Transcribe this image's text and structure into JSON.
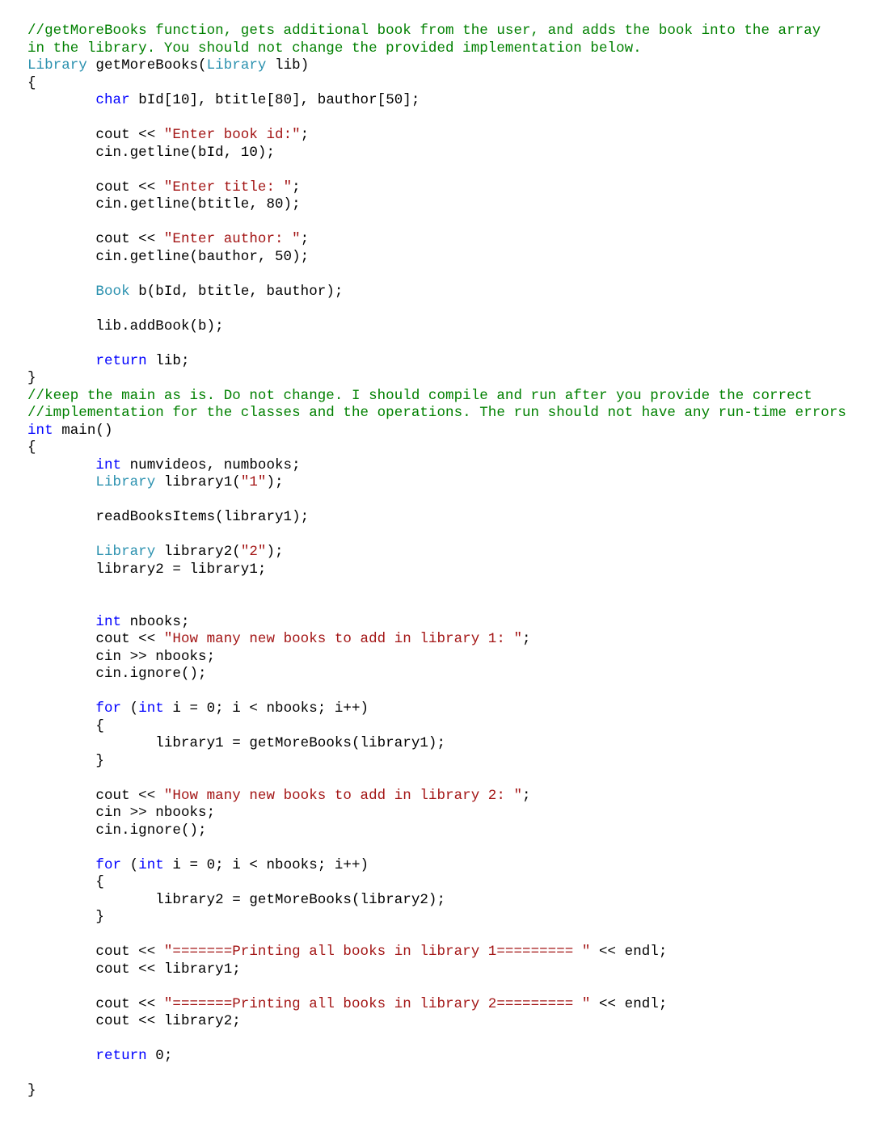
{
  "colors": {
    "comment": "#008000",
    "keyword": "#0000ff",
    "type": "#2b91af",
    "string": "#a31515",
    "text": "#000000",
    "background": "#ffffff"
  },
  "indent": "        ",
  "indent2": "               ",
  "tokens": [
    [
      "cmt",
      "//getMoreBooks function, gets additional book from the user, and adds the book into the array"
    ],
    [
      "nl"
    ],
    [
      "cmt",
      "in the library. You should not change the provided implementation below."
    ],
    [
      "nl"
    ],
    [
      "typ",
      "Library"
    ],
    [
      "pl",
      " getMoreBooks("
    ],
    [
      "typ",
      "Library"
    ],
    [
      "pl",
      " lib)"
    ],
    [
      "nl"
    ],
    [
      "pl",
      "{"
    ],
    [
      "nl"
    ],
    [
      "ind"
    ],
    [
      "kw",
      "char"
    ],
    [
      "pl",
      " bId[10], btitle[80], bauthor[50];"
    ],
    [
      "nl"
    ],
    [
      "nl"
    ],
    [
      "ind"
    ],
    [
      "pl",
      "cout << "
    ],
    [
      "str",
      "\"Enter book id:\""
    ],
    [
      "pl",
      ";"
    ],
    [
      "nl"
    ],
    [
      "ind"
    ],
    [
      "pl",
      "cin.getline(bId, 10);"
    ],
    [
      "nl"
    ],
    [
      "nl"
    ],
    [
      "ind"
    ],
    [
      "pl",
      "cout << "
    ],
    [
      "str",
      "\"Enter title: \""
    ],
    [
      "pl",
      ";"
    ],
    [
      "nl"
    ],
    [
      "ind"
    ],
    [
      "pl",
      "cin.getline(btitle, 80);"
    ],
    [
      "nl"
    ],
    [
      "nl"
    ],
    [
      "ind"
    ],
    [
      "pl",
      "cout << "
    ],
    [
      "str",
      "\"Enter author: \""
    ],
    [
      "pl",
      ";"
    ],
    [
      "nl"
    ],
    [
      "ind"
    ],
    [
      "pl",
      "cin.getline(bauthor, 50);"
    ],
    [
      "nl"
    ],
    [
      "nl"
    ],
    [
      "ind"
    ],
    [
      "typ",
      "Book"
    ],
    [
      "pl",
      " b(bId, btitle, bauthor);"
    ],
    [
      "nl"
    ],
    [
      "nl"
    ],
    [
      "ind"
    ],
    [
      "pl",
      "lib.addBook(b);"
    ],
    [
      "nl"
    ],
    [
      "nl"
    ],
    [
      "ind"
    ],
    [
      "kw",
      "return"
    ],
    [
      "pl",
      " lib;"
    ],
    [
      "nl"
    ],
    [
      "pl",
      "}"
    ],
    [
      "nl"
    ],
    [
      "cmt",
      "//keep the main as is. Do not change. I should compile and run after you provide the correct"
    ],
    [
      "nl"
    ],
    [
      "cmt",
      "//implementation for the classes and the operations. The run should not have any run-time errors"
    ],
    [
      "nl"
    ],
    [
      "kw",
      "int"
    ],
    [
      "pl",
      " main()"
    ],
    [
      "nl"
    ],
    [
      "pl",
      "{"
    ],
    [
      "nl"
    ],
    [
      "ind"
    ],
    [
      "kw",
      "int"
    ],
    [
      "pl",
      " numvideos, numbooks;"
    ],
    [
      "nl"
    ],
    [
      "ind"
    ],
    [
      "typ",
      "Library"
    ],
    [
      "pl",
      " library1("
    ],
    [
      "str",
      "\"1\""
    ],
    [
      "pl",
      ");"
    ],
    [
      "nl"
    ],
    [
      "nl"
    ],
    [
      "ind"
    ],
    [
      "pl",
      "readBooksItems(library1);"
    ],
    [
      "nl"
    ],
    [
      "nl"
    ],
    [
      "ind"
    ],
    [
      "typ",
      "Library"
    ],
    [
      "pl",
      " library2("
    ],
    [
      "str",
      "\"2\""
    ],
    [
      "pl",
      ");"
    ],
    [
      "nl"
    ],
    [
      "ind"
    ],
    [
      "pl",
      "library2 = library1;"
    ],
    [
      "nl"
    ],
    [
      "nl"
    ],
    [
      "nl"
    ],
    [
      "ind"
    ],
    [
      "kw",
      "int"
    ],
    [
      "pl",
      " nbooks;"
    ],
    [
      "nl"
    ],
    [
      "ind"
    ],
    [
      "pl",
      "cout << "
    ],
    [
      "str",
      "\"How many new books to add in library 1: \""
    ],
    [
      "pl",
      ";"
    ],
    [
      "nl"
    ],
    [
      "ind"
    ],
    [
      "pl",
      "cin >> nbooks;"
    ],
    [
      "nl"
    ],
    [
      "ind"
    ],
    [
      "pl",
      "cin.ignore();"
    ],
    [
      "nl"
    ],
    [
      "nl"
    ],
    [
      "ind"
    ],
    [
      "kw",
      "for"
    ],
    [
      "pl",
      " ("
    ],
    [
      "kw",
      "int"
    ],
    [
      "pl",
      " i = 0; i < nbooks; i++)"
    ],
    [
      "nl"
    ],
    [
      "ind"
    ],
    [
      "pl",
      "{"
    ],
    [
      "nl"
    ],
    [
      "ind2"
    ],
    [
      "pl",
      "library1 = getMoreBooks(library1);"
    ],
    [
      "nl"
    ],
    [
      "ind"
    ],
    [
      "pl",
      "}"
    ],
    [
      "nl"
    ],
    [
      "nl"
    ],
    [
      "ind"
    ],
    [
      "pl",
      "cout << "
    ],
    [
      "str",
      "\"How many new books to add in library 2: \""
    ],
    [
      "pl",
      ";"
    ],
    [
      "nl"
    ],
    [
      "ind"
    ],
    [
      "pl",
      "cin >> nbooks;"
    ],
    [
      "nl"
    ],
    [
      "ind"
    ],
    [
      "pl",
      "cin.ignore();"
    ],
    [
      "nl"
    ],
    [
      "nl"
    ],
    [
      "ind"
    ],
    [
      "kw",
      "for"
    ],
    [
      "pl",
      " ("
    ],
    [
      "kw",
      "int"
    ],
    [
      "pl",
      " i = 0; i < nbooks; i++)"
    ],
    [
      "nl"
    ],
    [
      "ind"
    ],
    [
      "pl",
      "{"
    ],
    [
      "nl"
    ],
    [
      "ind2"
    ],
    [
      "pl",
      "library2 = getMoreBooks(library2);"
    ],
    [
      "nl"
    ],
    [
      "ind"
    ],
    [
      "pl",
      "}"
    ],
    [
      "nl"
    ],
    [
      "nl"
    ],
    [
      "ind"
    ],
    [
      "pl",
      "cout << "
    ],
    [
      "str",
      "\"=======Printing all books in library 1========= \""
    ],
    [
      "pl",
      " << endl;"
    ],
    [
      "nl"
    ],
    [
      "ind"
    ],
    [
      "pl",
      "cout << library1;"
    ],
    [
      "nl"
    ],
    [
      "nl"
    ],
    [
      "ind"
    ],
    [
      "pl",
      "cout << "
    ],
    [
      "str",
      "\"=======Printing all books in library 2========= \""
    ],
    [
      "pl",
      " << endl;"
    ],
    [
      "nl"
    ],
    [
      "ind"
    ],
    [
      "pl",
      "cout << library2;"
    ],
    [
      "nl"
    ],
    [
      "nl"
    ],
    [
      "ind"
    ],
    [
      "kw",
      "return"
    ],
    [
      "pl",
      " 0;"
    ],
    [
      "nl"
    ],
    [
      "nl"
    ],
    [
      "pl",
      "}"
    ]
  ]
}
